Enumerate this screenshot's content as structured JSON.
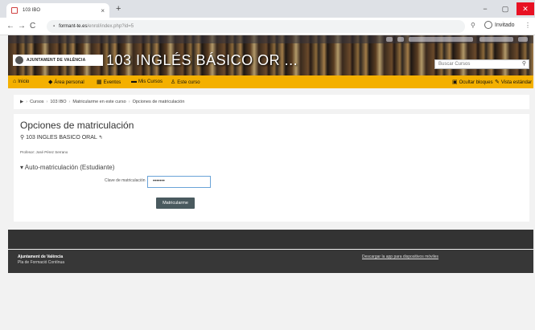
{
  "browser": {
    "tab_title": "103 IBO",
    "tab_close": "×",
    "new_tab": "+",
    "url_host": "formant-te.es",
    "url_path": "/enrol/index.php?id=5",
    "profile_label": "Invitado",
    "win_minimize": "−",
    "win_maximize": "▢",
    "win_close": "✕",
    "nav_back": "←",
    "nav_forward": "→",
    "nav_reload": "C",
    "zoom_icon": "⚲",
    "menu_dots": "⋮"
  },
  "site": {
    "logo_text": "AJUNTAMENT DE VALÈNCIA",
    "course_banner_title": "103 INGLÉS BÁSICO OR ...",
    "search_placeholder": "Buscar Cursos"
  },
  "nav": {
    "items": [
      {
        "icon": "home-icon",
        "label": "Inicio"
      },
      {
        "icon": "dashboard-icon",
        "label": "Área personal"
      },
      {
        "icon": "calendar-icon",
        "label": "Eventos"
      },
      {
        "icon": "courses-icon",
        "label": "Mis Cursos"
      },
      {
        "icon": "course-icon",
        "label": "Este curso"
      }
    ],
    "right_items": [
      {
        "icon": "blocks-icon",
        "label": "Ocultar bloques"
      },
      {
        "icon": "pencil-icon",
        "label": "Vista estándar"
      }
    ]
  },
  "breadcrumb": {
    "items": [
      "Cursos",
      "103 IBO",
      "Matricularme en este curso",
      "Opciones de matriculación"
    ]
  },
  "content": {
    "page_title": "Opciones de matriculación",
    "course_name": "103 INGLES BASICO ORAL",
    "professor": "Profesor: José Pérez Serrano",
    "section_title": "Auto-matriculación (Estudiante)",
    "key_label": "Clave de matriculación",
    "key_value": "•••••••",
    "enrol_button": "Matricularme"
  },
  "footer": {
    "org": "Ajuntament de València",
    "sub": "Pla de Formació Contínua",
    "app_link": "Descargar la app para dispositivos móviles"
  },
  "colors": {
    "nav_yellow": "#f4b000",
    "button_gray": "#4a5a5f",
    "footer_dark": "#333333"
  }
}
